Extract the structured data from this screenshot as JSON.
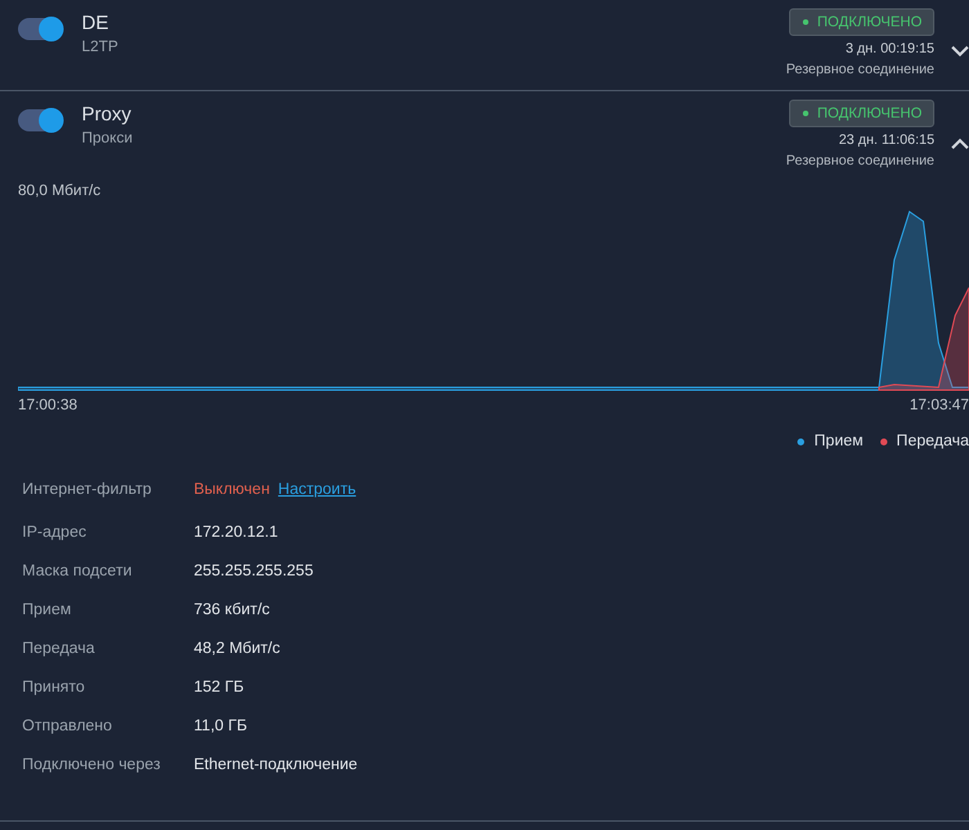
{
  "connections": [
    {
      "name": "DE",
      "type": "L2TP",
      "enabled": true,
      "status": "ПОДКЛЮЧЕНО",
      "connected": true,
      "uptime": "3 дн. 00:19:15",
      "note": "Резервное соединение",
      "expanded": false
    },
    {
      "name": "Proxy",
      "type": "Прокси",
      "enabled": true,
      "status": "ПОДКЛЮЧЕНО",
      "connected": true,
      "uptime": "23 дн. 11:06:15",
      "note": "Резервное соединение",
      "expanded": true,
      "chart": {
        "y_label": "80,0 Мбит/с",
        "x_start": "17:00:38",
        "x_end": "17:03:47",
        "legend": [
          {
            "label": "Прием",
            "color": "#2a9fe0"
          },
          {
            "label": "Передача",
            "color": "#e04a55"
          }
        ]
      },
      "details": [
        {
          "label": "Интернет-фильтр",
          "value": "Выключен",
          "kind": "status_off",
          "link": "Настроить"
        },
        {
          "label": "IP-адрес",
          "value": "172.20.12.1",
          "kind": "text"
        },
        {
          "label": "Маска подсети",
          "value": "255.255.255.255",
          "kind": "text"
        },
        {
          "label": "Прием",
          "value": "736 кбит/с",
          "kind": "text"
        },
        {
          "label": "Передача",
          "value": "48,2 Мбит/с",
          "kind": "text"
        },
        {
          "label": "Принято",
          "value": "152 ГБ",
          "kind": "text"
        },
        {
          "label": "Отправлено",
          "value": "11,0 ГБ",
          "kind": "text"
        },
        {
          "label": "Подключено через",
          "value": "Ethernet-подключение",
          "kind": "text"
        }
      ]
    }
  ]
}
